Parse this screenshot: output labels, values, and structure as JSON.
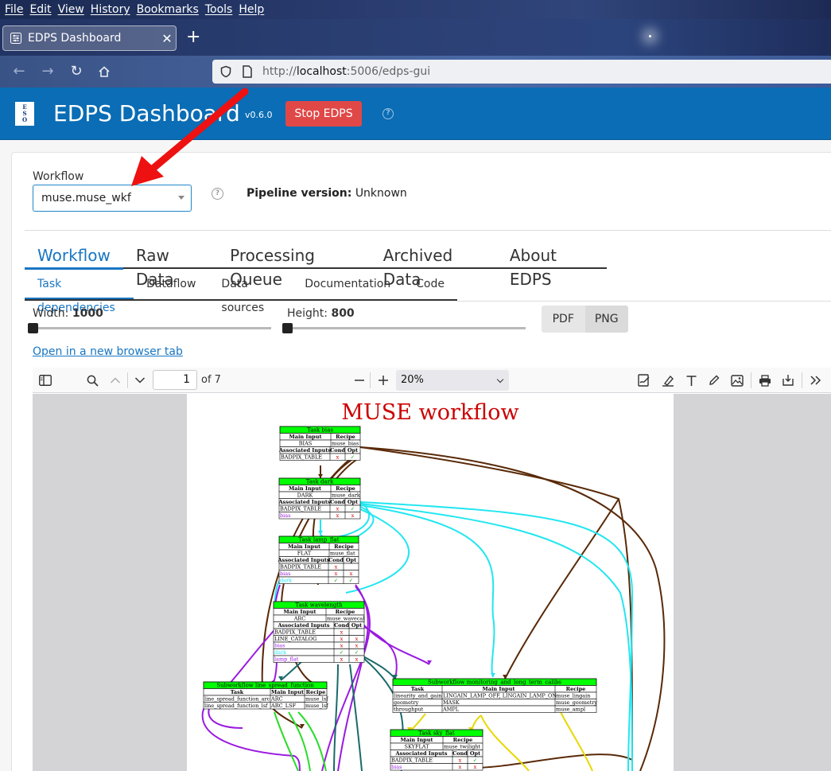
{
  "browser": {
    "menu": [
      "File",
      "Edit",
      "View",
      "History",
      "Bookmarks",
      "Tools",
      "Help"
    ],
    "tab_title": "EDPS Dashboard",
    "url_prefix": "http://",
    "url_host": "localhost",
    "url_rest": ":5006/edps-gui"
  },
  "header": {
    "logo_text": "ESO",
    "title": "EDPS Dashboard",
    "version": "v0.6.0",
    "stop_button": "Stop EDPS",
    "help": "?"
  },
  "workflow": {
    "label": "Workflow",
    "selected": "muse.muse_wkf",
    "pipeline_label": "Pipeline version:",
    "pipeline_value": "Unknown",
    "help": "?"
  },
  "main_tabs": [
    "Workflow",
    "Raw Data",
    "Processing Queue",
    "Archived Data",
    "About EDPS"
  ],
  "sub_tabs": [
    "Task dependencies",
    "Dataflow",
    "Data sources",
    "Documentation",
    "Code"
  ],
  "controls": {
    "width_label": "Width:",
    "width_value": "1000",
    "height_label": "Height:",
    "height_value": "800",
    "width_level": 0,
    "height_level": 0,
    "pdf_button": "PDF",
    "png_button": "PNG",
    "open_link": "Open in a new browser tab"
  },
  "pdf_viewer": {
    "page_number": "1",
    "page_count": "of 7",
    "zoom": "20%"
  },
  "diagram": {
    "title": "MUSE workflow",
    "tasks": {
      "bias": {
        "title": "Task bias",
        "main_header": [
          "Main Input",
          "Recipe"
        ],
        "main_rows": [
          [
            "BIAS",
            "muse_bias"
          ]
        ],
        "assoc_header": [
          "Associated Inputs",
          "Cond",
          "Opt"
        ],
        "assoc_rows": [
          [
            "BADPIX_TABLE",
            "x",
            "✓"
          ]
        ]
      },
      "dark": {
        "title": "Task dark",
        "main_header": [
          "Main Input",
          "Recipe"
        ],
        "main_rows": [
          [
            "DARK",
            "muse_dark"
          ]
        ],
        "assoc_header": [
          "Associated Inputs",
          "Cond",
          "Opt"
        ],
        "assoc_rows": [
          [
            "BADPIX_TABLE",
            "x",
            "✓"
          ],
          [
            "bias",
            "x",
            "x"
          ]
        ]
      },
      "lamp_flat": {
        "title": "Task lamp_flat",
        "main_header": [
          "Main Input",
          "Recipe"
        ],
        "main_rows": [
          [
            "FLAT",
            "muse_flat"
          ]
        ],
        "assoc_header": [
          "Associated Inputs",
          "Cond",
          "Opt"
        ],
        "assoc_rows": [
          [
            "BADPIX_TABLE",
            "x",
            ""
          ],
          [
            "bias",
            "x",
            "x"
          ],
          [
            "dark",
            "✓",
            "✓"
          ]
        ]
      },
      "wavelength": {
        "title": "Task wavelength",
        "main_header": [
          "Main Input",
          "Recipe"
        ],
        "main_rows": [
          [
            "ARC",
            "muse_wavecal"
          ]
        ],
        "assoc_header": [
          "Associated Inputs",
          "Cond",
          "Opt"
        ],
        "assoc_rows": [
          [
            "BADPIX_TABLE",
            "x",
            ""
          ],
          [
            "LINE_CATALOG",
            "x",
            "x"
          ],
          [
            "bias",
            "x",
            "x"
          ],
          [
            "dark",
            "✓",
            "✓"
          ],
          [
            "lamp_flat",
            "x",
            "x"
          ]
        ]
      },
      "lsf": {
        "title": "Subworkflow line_spread_function",
        "header": [
          "Task",
          "Main Input",
          "Recipe"
        ],
        "rows": [
          [
            "line_spread_function_arc",
            "ARC",
            "muse_lsf"
          ],
          [
            "line_spread_function_lsf",
            "ARC_LSF",
            "muse_lsf"
          ]
        ]
      },
      "monitoring": {
        "title": "Subworkflow monitoring_and_long_term_calibs",
        "header": [
          "Task",
          "Main Input",
          "Recipe"
        ],
        "rows": [
          [
            "linearity_and_gain",
            "LINGAIN_LAMP_OFF, LINGAIN_LAMP_ON",
            "muse_lingain"
          ],
          [
            "geometry",
            "MASK",
            "muse_geometry"
          ],
          [
            "throughput",
            "AMPL",
            "muse_ampl"
          ]
        ]
      },
      "sky_flat": {
        "title": "Task sky_flat",
        "main_header": [
          "Main Input",
          "Recipe"
        ],
        "main_rows": [
          [
            "SKYFLAT",
            "muse_twilight"
          ]
        ],
        "assoc_header": [
          "Associated Inputs",
          "Cond",
          "Opt"
        ],
        "assoc_rows": [
          [
            "BADPIX_TABLE",
            "x",
            "✓"
          ],
          [
            "bias",
            "x",
            "x"
          ]
        ]
      }
    }
  },
  "colors": {
    "header_blue": "#0a6db5",
    "stop_red": "#e04848",
    "accent": "#1976c2",
    "task_green": "#00ff00",
    "title_red": "#cc0000",
    "edge_brown": "#5a2a08",
    "edge_cyan": "#22e6f0",
    "edge_purple": "#9a1ae0",
    "edge_teal": "#1a6a6a",
    "edge_yellow": "#e8d800",
    "edge_green": "#2adc2a",
    "annotation_arrow": "#ee1111"
  }
}
